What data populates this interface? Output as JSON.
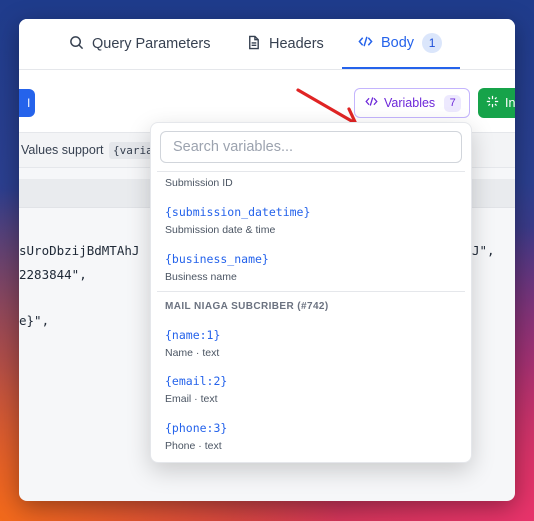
{
  "tabs": [
    {
      "label": "Query Parameters",
      "icon": "search-icon"
    },
    {
      "label": "Headers",
      "icon": "document-icon"
    },
    {
      "label": "Body",
      "icon": "code-icon",
      "badge": "1",
      "active": true
    }
  ],
  "toolbar": {
    "blue_button_label": "l",
    "variables_button": {
      "label": "Variables",
      "count": "7",
      "icon": "code-icon"
    },
    "green_button": {
      "label": "In",
      "icon": "sparkle-icon"
    }
  },
  "hint": {
    "text": "Values support",
    "code": "{varia"
  },
  "code_lines": [
    "sUroDbzijBdMTAhJ",
    "J\",",
    "2283844\",",
    "e}\","
  ],
  "variables_dropdown": {
    "search_placeholder": "Search variables...",
    "partial_item_desc": "Submission ID",
    "items": [
      {
        "code": "{submission_datetime}",
        "desc": "Submission date & time"
      },
      {
        "code": "{business_name}",
        "desc": "Business name"
      }
    ],
    "group_title": "MAIL NIAGA SUBCRIBER (#742)",
    "group_items": [
      {
        "code": "{name:1}",
        "desc": "Name · text"
      },
      {
        "code": "{email:2}",
        "desc": "Email · text"
      },
      {
        "code": "{phone:3}",
        "desc": "Phone · text"
      }
    ]
  },
  "colors": {
    "accent_blue": "#2563eb",
    "variables_purple": "#6d28d9",
    "insert_green": "#16a34a",
    "annotation_red": "#e02424"
  }
}
